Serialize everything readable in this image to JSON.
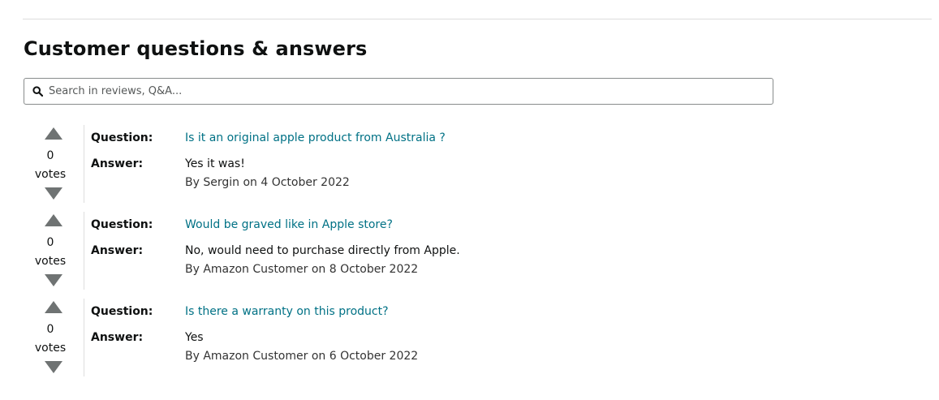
{
  "section": {
    "title": "Customer questions & answers"
  },
  "search": {
    "placeholder": "Search in reviews, Q&A...",
    "icon": "magnifier"
  },
  "colors": {
    "link": "#007185",
    "text": "#0f1111",
    "arrow": "#6f7373",
    "border": "#888c8c"
  },
  "labels": {
    "question": "Question:",
    "answer": "Answer:",
    "votes": "votes"
  },
  "questions": [
    {
      "votes": "0",
      "question": "Is it an original apple product from Australia ?",
      "answer": "Yes it was!",
      "byline": "By Sergin on 4 October 2022"
    },
    {
      "votes": "0",
      "question": "Would be graved like in Apple store?",
      "answer": "No, would need to purchase directly from Apple.",
      "byline": "By Amazon Customer on 8 October 2022"
    },
    {
      "votes": "0",
      "question": "Is there a warranty on this product?",
      "answer": "Yes",
      "byline": "By Amazon Customer on 6 October 2022"
    }
  ]
}
